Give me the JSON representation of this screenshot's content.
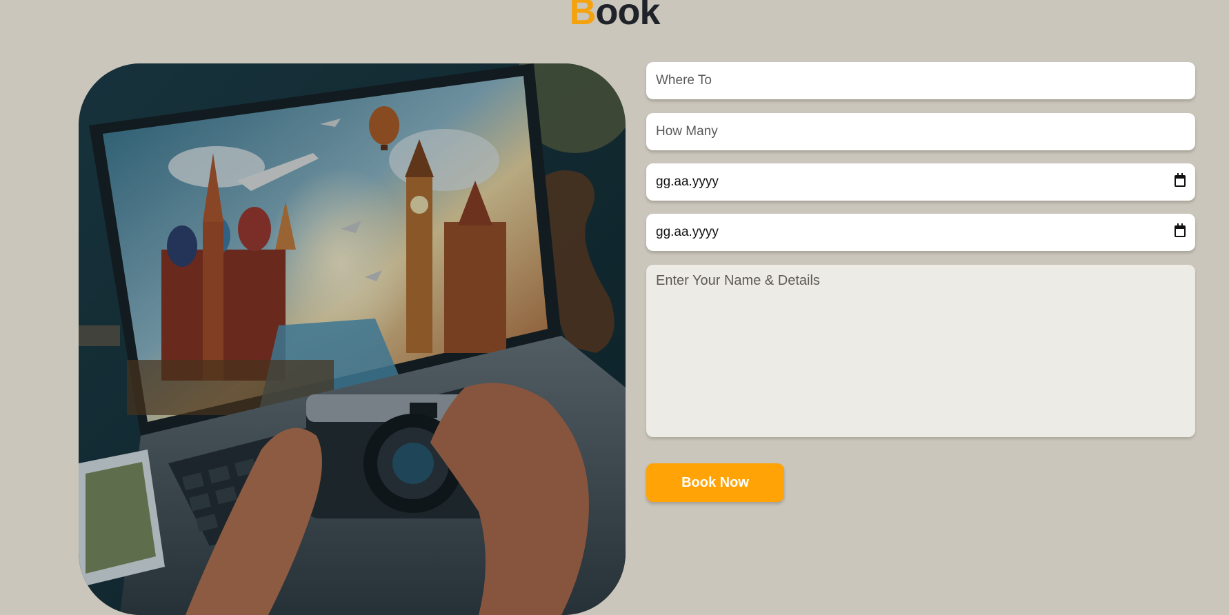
{
  "heading": {
    "first_letter": "B",
    "rest": "ook"
  },
  "image": {
    "description_icon": "travel-photo-laptop-camera"
  },
  "form": {
    "where_to": {
      "placeholder": "Where To"
    },
    "how_many": {
      "placeholder": "How Many"
    },
    "arrival_date": {
      "value": "gg.aa.yyyy"
    },
    "leaving_date": {
      "value": "gg.aa.yyyy"
    },
    "details": {
      "placeholder": "Enter Your Name & Details"
    },
    "submit_label": "Book Now"
  },
  "colors": {
    "background": "#cbc6bb",
    "accent": "#ffa307",
    "heading": "#1f2329"
  }
}
